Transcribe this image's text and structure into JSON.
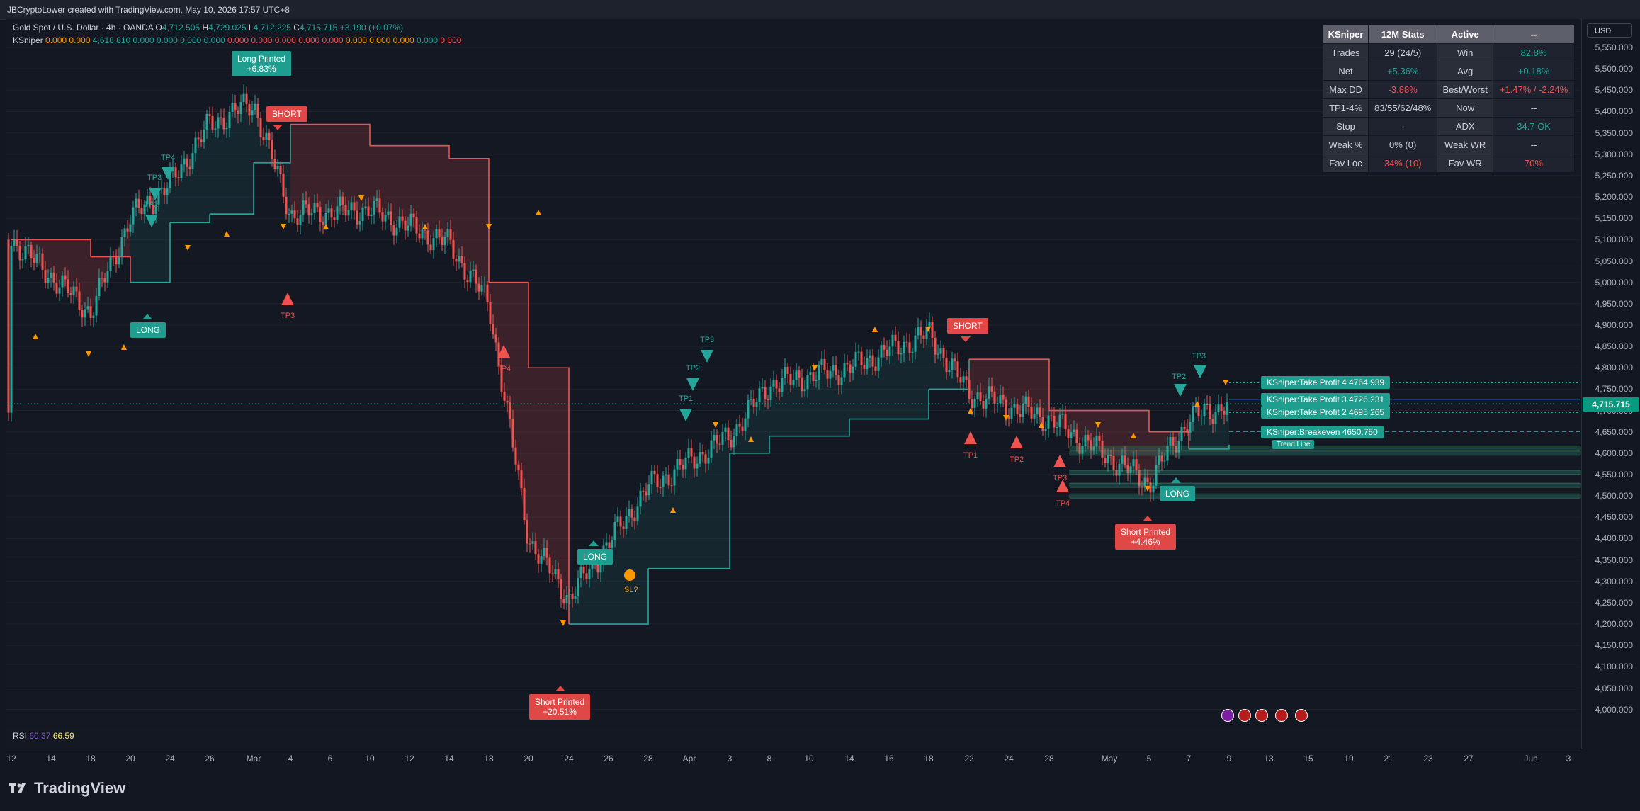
{
  "header": {
    "text": "JBCryptoLower created with TradingView.com, May 10, 2026 17:57 UTC+8"
  },
  "legend": {
    "symbol": "Gold Spot / U.S. Dollar · 4h · OANDA",
    "ohlc": [
      {
        "key": "O",
        "value": "4,712.505"
      },
      {
        "key": "H",
        "value": "4,729.025"
      },
      {
        "key": "L",
        "value": "4,712.225"
      },
      {
        "key": "C",
        "value": "4,715.715"
      }
    ],
    "change": "+3.190 (+0.07%)",
    "indicator": "KSniper",
    "indicator_values": [
      "0.000",
      "0.000",
      "4,618.810",
      "0.000",
      "0.000",
      "0.000",
      "0.000",
      "0.000",
      "0.000",
      "0.000",
      "0.000",
      "0.000",
      "0.000",
      "0.000",
      "0.000",
      "0.000",
      "0.000"
    ],
    "indicator_colors": [
      "#ff9800",
      "#ff9800",
      "#26a69a",
      "#26a69a",
      "#26a69a",
      "#26a69a",
      "#26a69a",
      "#ef5350",
      "#ef5350",
      "#ef5350",
      "#ef5350",
      "#ef5350",
      "#ff9800",
      "#ff9800",
      "#ff9800",
      "#26a69a",
      "#ef5350"
    ]
  },
  "rsi": {
    "label": "RSI",
    "value1": "60.37",
    "value2": "66.59"
  },
  "yaxis": {
    "currency": "USD",
    "ticks": [
      "5,550.000",
      "5,500.000",
      "5,450.000",
      "5,400.000",
      "5,350.000",
      "5,300.000",
      "5,250.000",
      "5,200.000",
      "5,150.000",
      "5,100.000",
      "5,050.000",
      "5,000.000",
      "4,950.000",
      "4,900.000",
      "4,850.000",
      "4,800.000",
      "4,750.000",
      "4,700.000",
      "4,650.000",
      "4,600.000",
      "4,550.000",
      "4,500.000",
      "4,450.000",
      "4,400.000",
      "4,350.000",
      "4,300.000",
      "4,250.000",
      "4,200.000",
      "4,150.000",
      "4,100.000",
      "4,050.000",
      "4,000.000"
    ],
    "last_price": "4,715.715"
  },
  "xaxis": {
    "ticks": [
      "12",
      "14",
      "18",
      "20",
      "24",
      "26",
      "Mar",
      "4",
      "6",
      "10",
      "12",
      "14",
      "18",
      "20",
      "24",
      "26",
      "28",
      "Apr",
      "3",
      "8",
      "10",
      "14",
      "16",
      "18",
      "22",
      "24",
      "28",
      "May",
      "5",
      "7",
      "9",
      "13",
      "15",
      "19",
      "21",
      "23",
      "27",
      "Jun",
      "3"
    ]
  },
  "stats": {
    "header": [
      "KSniper",
      "12M Stats",
      "Active",
      "--"
    ],
    "rows": [
      [
        "Trades",
        "29 (24/5)",
        "Win",
        "82.8%"
      ],
      [
        "Net",
        "+5.36%",
        "Avg",
        "+0.18%"
      ],
      [
        "Max DD",
        "-3.88%",
        "Best/Worst",
        "+1.47% / -2.24%"
      ],
      [
        "TP1-4%",
        "83/55/62/48%",
        "Now",
        "--"
      ],
      [
        "Stop",
        "--",
        "ADX",
        "34.7 OK"
      ],
      [
        "Weak %",
        "0% (0)",
        "Weak WR",
        "--"
      ],
      [
        "Fav Loc",
        "34% (10)",
        "Fav WR",
        "70%"
      ]
    ]
  },
  "signals": {
    "long_printed": "Long Printed\n+6.83%",
    "short_printed_1": "Short Printed\n+20.51%",
    "short_printed_2": "Short Printed\n+4.46%",
    "long": "LONG",
    "short": "SHORT",
    "sl": "SL?",
    "tp1": "TP1",
    "tp2": "TP2",
    "tp3": "TP3",
    "tp4": "TP4"
  },
  "tp_lines": {
    "tp4": "KSniper:Take Profit 4  4764.939",
    "tp3": "KSniper:Take Profit 3  4726.231",
    "tp2": "KSniper:Take Profit 2  4695.265",
    "be": "KSniper:Breakeven  4650.750",
    "trend": "Trend Line"
  },
  "footer": {
    "logo": "TradingView"
  },
  "colors": {
    "up": "#26a69a",
    "down": "#ef5350",
    "bg": "#131722",
    "accent": "#2962ff"
  },
  "chart_data": {
    "type": "candlestick",
    "ylim": [
      4000,
      5550
    ],
    "x": [
      "Feb 12",
      "Feb 18",
      "Feb 20",
      "Feb 24",
      "Feb 26",
      "Mar 2",
      "Mar 4",
      "Mar 10",
      "Mar 14",
      "Mar 18",
      "Mar 20",
      "Mar 24",
      "Mar 28",
      "Apr 3",
      "Apr 8",
      "Apr 14",
      "Apr 18",
      "Apr 22",
      "Apr 28",
      "May 5",
      "May 7",
      "May 9"
    ],
    "close": [
      5100,
      4930,
      5150,
      5230,
      5370,
      5420,
      5160,
      5170,
      5090,
      4950,
      4400,
      4260,
      4520,
      4640,
      4760,
      4800,
      4880,
      4740,
      4680,
      4530,
      4680,
      4716
    ],
    "supertrend": [
      {
        "x": "Feb 12",
        "y": 5100,
        "side": "short"
      },
      {
        "x": "Feb 18",
        "y": 5060,
        "side": "short"
      },
      {
        "x": "Feb 20",
        "y": 5000,
        "side": "long"
      },
      {
        "x": "Feb 24",
        "y": 5140,
        "side": "long"
      },
      {
        "x": "Feb 26",
        "y": 5160,
        "side": "long"
      },
      {
        "x": "Mar 2",
        "y": 5280,
        "side": "long"
      },
      {
        "x": "Mar 4",
        "y": 5370,
        "side": "short"
      },
      {
        "x": "Mar 10",
        "y": 5320,
        "side": "short"
      },
      {
        "x": "Mar 14",
        "y": 5290,
        "side": "short"
      },
      {
        "x": "Mar 18",
        "y": 5000,
        "side": "short"
      },
      {
        "x": "Mar 20",
        "y": 4800,
        "side": "short"
      },
      {
        "x": "Mar 24",
        "y": 4200,
        "side": "long"
      },
      {
        "x": "Mar 28",
        "y": 4330,
        "side": "long"
      },
      {
        "x": "Apr 3",
        "y": 4600,
        "side": "long"
      },
      {
        "x": "Apr 8",
        "y": 4640,
        "side": "long"
      },
      {
        "x": "Apr 14",
        "y": 4680,
        "side": "long"
      },
      {
        "x": "Apr 18",
        "y": 4750,
        "side": "long"
      },
      {
        "x": "Apr 22",
        "y": 4820,
        "side": "short"
      },
      {
        "x": "Apr 28",
        "y": 4700,
        "side": "short"
      },
      {
        "x": "May 5",
        "y": 4650,
        "side": "short"
      },
      {
        "x": "May 7",
        "y": 4610,
        "side": "long"
      },
      {
        "x": "May 9",
        "y": 4620,
        "side": "long"
      }
    ]
  }
}
